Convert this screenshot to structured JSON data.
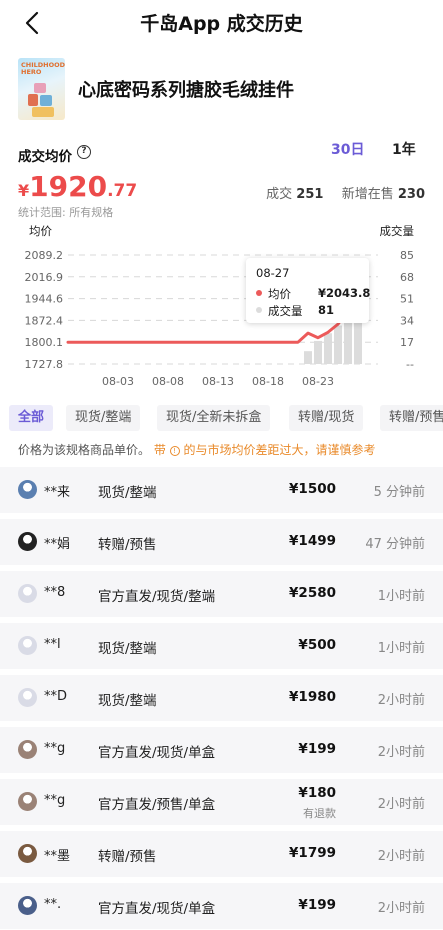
{
  "nav": {
    "title": "千岛App 成交历史"
  },
  "product": {
    "name": "心底密码系列搪胶毛绒挂件",
    "thumb_text": "CHILDHOOD HERO"
  },
  "summary": {
    "avg_label": "成交均价",
    "range_tabs": [
      "30日",
      "1年"
    ],
    "active_range": "30日",
    "price_currency": "¥",
    "price_int": "1920",
    "price_dec": ".77",
    "deals_label": "成交",
    "deals_count": "251",
    "new_on_sale_label": "新增在售",
    "new_on_sale_count": "230",
    "scope": "统计范围: 所有规格"
  },
  "chart_data": {
    "type": "line",
    "left_axis_title": "均价",
    "right_axis_title": "成交量",
    "x_ticks": [
      "08-03",
      "08-08",
      "08-13",
      "08-18",
      "08-23"
    ],
    "y_ticks_left": [
      "2089.2",
      "2016.9",
      "1944.6",
      "1872.4",
      "1800.1",
      "1727.8"
    ],
    "y_ticks_right": [
      "85",
      "68",
      "51",
      "34",
      "17",
      "--"
    ],
    "ylim_left": [
      1727.8,
      2089.2
    ],
    "ylim_right": [
      0,
      85
    ],
    "series": [
      {
        "name": "均价",
        "color": "#ec5a5a",
        "points": [
          [
            "07-29",
            1800.1
          ],
          [
            "08-03",
            1800.1
          ],
          [
            "08-08",
            1800.1
          ],
          [
            "08-13",
            1800.1
          ],
          [
            "08-18",
            1800.1
          ],
          [
            "08-21",
            1800.1
          ],
          [
            "08-22",
            1830
          ],
          [
            "08-23",
            1815
          ],
          [
            "08-24",
            1833
          ],
          [
            "08-25",
            1860
          ],
          [
            "08-26",
            1905
          ],
          [
            "08-27",
            2043.8
          ]
        ]
      },
      {
        "name": "成交量",
        "color": "#dcdcdc",
        "points": [
          [
            "08-22",
            10
          ],
          [
            "08-23",
            18
          ],
          [
            "08-24",
            24
          ],
          [
            "08-25",
            30
          ],
          [
            "08-26",
            42
          ],
          [
            "08-27",
            81
          ]
        ]
      }
    ],
    "tooltip": {
      "date": "08-27",
      "avg_label": "均价",
      "avg_value": "¥2043.8",
      "vol_label": "成交量",
      "vol_value": "81"
    },
    "grid": true
  },
  "filters": [
    "全部",
    "现货/整端",
    "现货/全新未拆盒",
    "转赠/现货",
    "转赠/预售"
  ],
  "active_filter": "全部",
  "note": {
    "text": "价格为该规格商品单价。",
    "warn_prefix": "带",
    "warn_icon": "!",
    "warn_text": "的与市场均价差距过大，请谨慎参考"
  },
  "transactions": [
    {
      "user": "**来",
      "spec": "现货/整端",
      "price": "¥1500",
      "time": "5 分钟前",
      "avatar_color": "#5a7fb0"
    },
    {
      "user": "**娟",
      "spec": "转赠/预售",
      "price": "¥1499",
      "time": "47 分钟前",
      "avatar_color": "#222222"
    },
    {
      "user": "**8",
      "spec": "官方直发/现货/整端",
      "price": "¥2580",
      "time": "1小时前",
      "avatar_color": "#d9dbe6"
    },
    {
      "user": "**l",
      "spec": "现货/整端",
      "price": "¥500",
      "time": "1小时前",
      "avatar_color": "#d9dbe6"
    },
    {
      "user": "**D",
      "spec": "现货/整端",
      "price": "¥1980",
      "time": "2小时前",
      "avatar_color": "#d9dbe6"
    },
    {
      "user": "**g",
      "spec": "官方直发/现货/单盒",
      "price": "¥199",
      "time": "2小时前",
      "avatar_color": "#9a8276"
    },
    {
      "user": "**g",
      "spec": "官方直发/预售/单盒",
      "price": "¥180",
      "refund": "有退款",
      "time": "2小时前",
      "avatar_color": "#9a8276"
    },
    {
      "user": "**墨",
      "spec": "转赠/预售",
      "price": "¥1799",
      "time": "2小时前",
      "avatar_color": "#7a5a40"
    },
    {
      "user": "**.",
      "spec": "官方直发/现货/单盒",
      "price": "¥199",
      "time": "2小时前",
      "avatar_color": "#4a5f8a"
    }
  ]
}
